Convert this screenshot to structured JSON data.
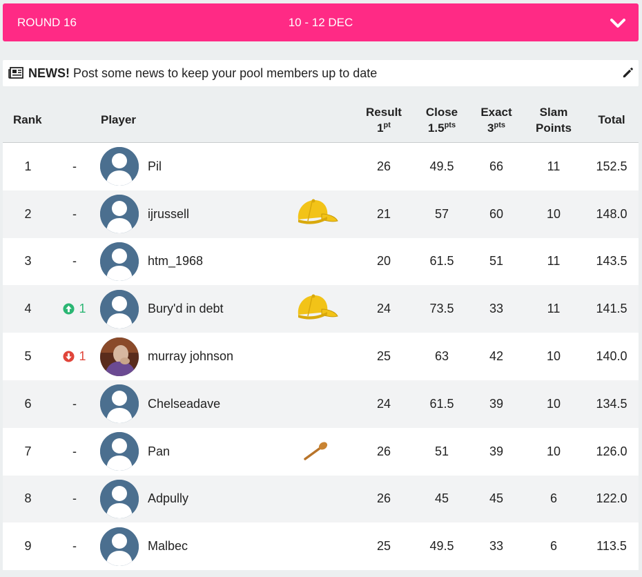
{
  "header": {
    "round": "ROUND 16",
    "dates": "10 - 12 DEC"
  },
  "news": {
    "title": "NEWS!",
    "message": "Post some news to keep your pool members up to date"
  },
  "columns": {
    "rank": "Rank",
    "player": "Player",
    "result": "Result",
    "result_sub": "1",
    "result_sup": "pt",
    "close": "Close",
    "close_sub": "1.5",
    "close_sup": "pts",
    "exact": "Exact",
    "exact_sub": "3",
    "exact_sup": "pts",
    "slam1": "Slam",
    "slam2": "Points",
    "total": "Total"
  },
  "colors": {
    "accent": "#ff2a85",
    "up": "#2bb673",
    "down": "#e0453a",
    "avatar_bg": "#4b6f8f",
    "cap": "#f2c318"
  },
  "rows": [
    {
      "rank": "1",
      "move": "-",
      "dir": "none",
      "name": "Pil",
      "badge": "",
      "result": "26",
      "close": "49.5",
      "exact": "66",
      "slam": "11",
      "total": "152.5",
      "avatar": "default"
    },
    {
      "rank": "2",
      "move": "-",
      "dir": "none",
      "name": "ijrussell",
      "badge": "cap-icon",
      "result": "21",
      "close": "57",
      "exact": "60",
      "slam": "10",
      "total": "148.0",
      "avatar": "default"
    },
    {
      "rank": "3",
      "move": "-",
      "dir": "none",
      "name": "htm_1968",
      "badge": "",
      "result": "20",
      "close": "61.5",
      "exact": "51",
      "slam": "11",
      "total": "143.5",
      "avatar": "default"
    },
    {
      "rank": "4",
      "move": "1",
      "dir": "up",
      "name": "Bury'd in debt",
      "badge": "cap-icon",
      "result": "24",
      "close": "73.5",
      "exact": "33",
      "slam": "11",
      "total": "141.5",
      "avatar": "default"
    },
    {
      "rank": "5",
      "move": "1",
      "dir": "down",
      "name": "murray johnson",
      "badge": "",
      "result": "25",
      "close": "63",
      "exact": "42",
      "slam": "10",
      "total": "140.0",
      "avatar": "photo"
    },
    {
      "rank": "6",
      "move": "-",
      "dir": "none",
      "name": "Chelseadave",
      "badge": "",
      "result": "24",
      "close": "61.5",
      "exact": "39",
      "slam": "10",
      "total": "134.5",
      "avatar": "default"
    },
    {
      "rank": "7",
      "move": "-",
      "dir": "none",
      "name": "Pan",
      "badge": "wooden-spoon-icon",
      "result": "26",
      "close": "51",
      "exact": "39",
      "slam": "10",
      "total": "126.0",
      "avatar": "default"
    },
    {
      "rank": "8",
      "move": "-",
      "dir": "none",
      "name": "Adpully",
      "badge": "",
      "result": "26",
      "close": "45",
      "exact": "45",
      "slam": "6",
      "total": "122.0",
      "avatar": "default"
    },
    {
      "rank": "9",
      "move": "-",
      "dir": "none",
      "name": "Malbec",
      "badge": "",
      "result": "25",
      "close": "49.5",
      "exact": "33",
      "slam": "6",
      "total": "113.5",
      "avatar": "default"
    }
  ]
}
